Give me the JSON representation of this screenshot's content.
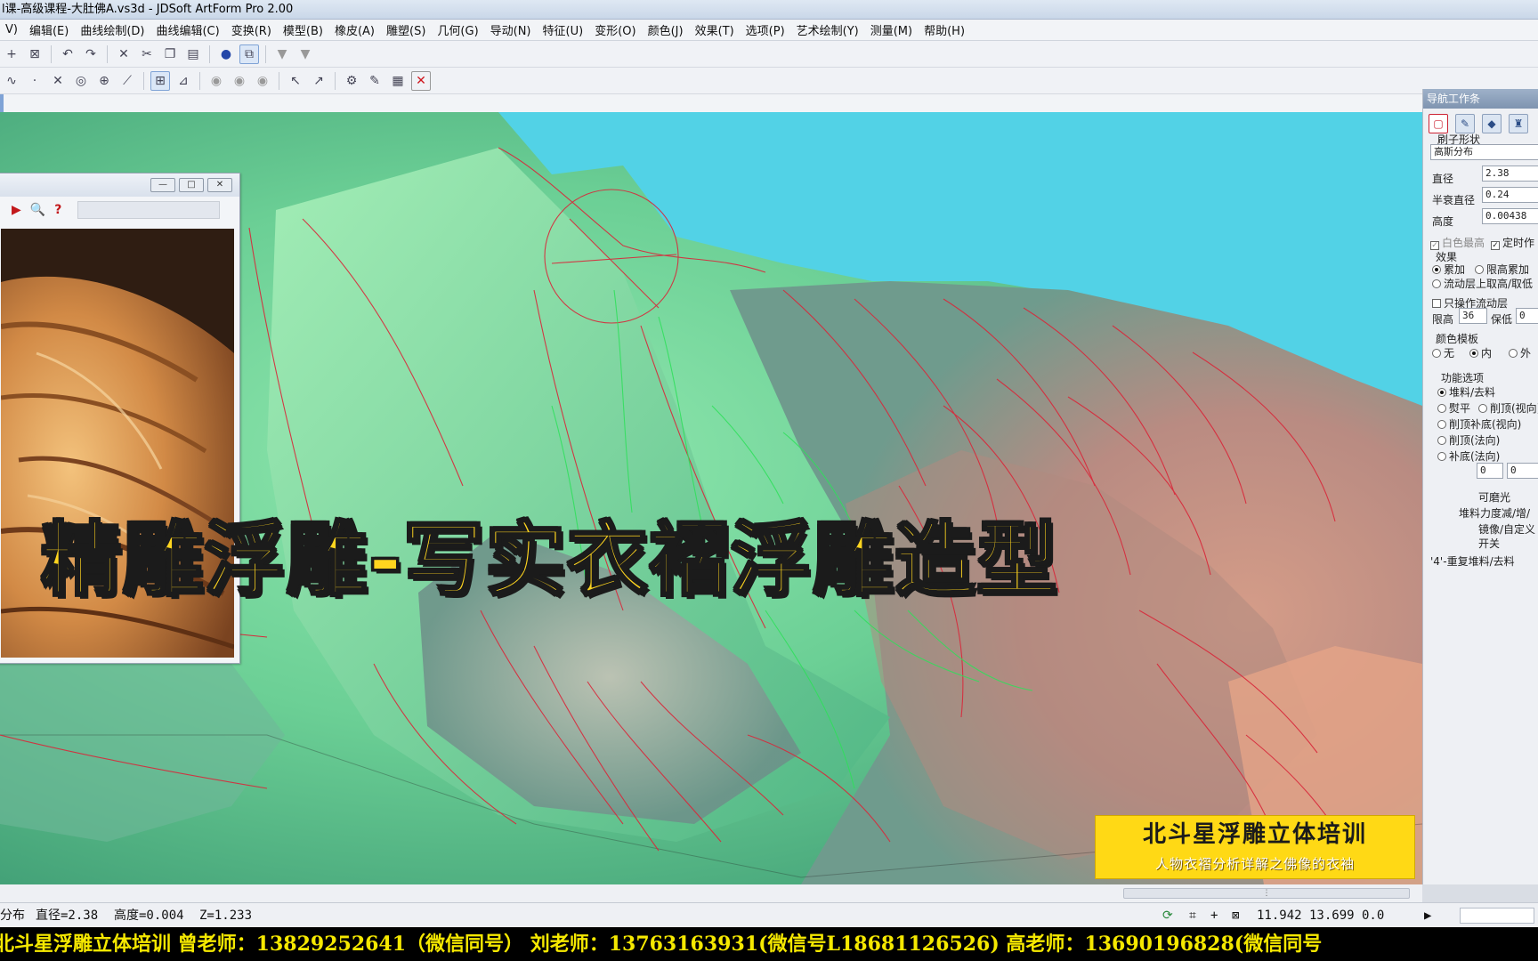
{
  "window": {
    "title": "l课-高级课程-大肚佛A.vs3d - JDSoft ArtForm Pro 2.00"
  },
  "menu": [
    "V)",
    "编辑(E)",
    "曲线绘制(D)",
    "曲线编辑(C)",
    "变换(R)",
    "模型(B)",
    "橡皮(A)",
    "雕塑(S)",
    "几何(G)",
    "导动(N)",
    "特征(U)",
    "变形(O)",
    "颜色(J)",
    "效果(T)",
    "选项(P)",
    "艺术绘制(Y)",
    "测量(M)",
    "帮助(H)"
  ],
  "toolbar1_icons": [
    "axis-icon",
    "frame-icon",
    "undo-icon",
    "redo-icon",
    "delete-icon",
    "cut-icon",
    "copy-icon",
    "paste-icon",
    "sphere-render-icon",
    "view-box-icon",
    "shade-icon",
    "shade-alt-icon"
  ],
  "toolbar2_icons": [
    "curve-icon",
    "point-icon",
    "cross-icon",
    "circle-icon",
    "target-icon",
    "trim-icon",
    "grid-icon",
    "snap-icon",
    "eye-icon",
    "eye2-icon",
    "eye3-icon",
    "select-icon",
    "select2-icon",
    "tool-icon",
    "brush-icon",
    "layer-icon",
    "close-red-icon"
  ],
  "ref_window": {
    "buttons": [
      "—",
      "□",
      "✕"
    ],
    "tools": [
      "▶",
      "🔍",
      "?"
    ]
  },
  "nav_panel": {
    "title": "导航工作条",
    "brush_shape_label": "刷子形状",
    "brush_shape_value": "高斯分布",
    "diameter_label": "直径",
    "diameter_value": "2.38",
    "half_decay_label": "半衰直径",
    "half_decay_value": "0.24",
    "height_label": "高度",
    "height_value": "0.00438",
    "white_max_label": "白色最高",
    "timed_label": "定时作",
    "effect_label": "效果",
    "effect_accumulate": "累加",
    "effect_limit_accumulate": "限高累加",
    "effect_flow_layer": "流动层上取高/取低",
    "only_flow_layer": "只操作流动层",
    "limit_high_label": "限高",
    "limit_high_value": "36",
    "keep_low_label": "保低",
    "keep_low_value": "0",
    "color_template_label": "颜色模板",
    "color_none": "无",
    "color_inner": "内",
    "color_outer": "外",
    "function_label": "功能选项",
    "fn_pile": "堆料/去料",
    "fn_flatten": "熨平",
    "fn_cut_top": "削顶(视向)",
    "fn_cut_fill": "削顶补底(视向)",
    "fn_cut_normal": "削顶(法向)",
    "fn_fill_normal": "补底(法向)",
    "fn_val1": "0",
    "fn_val2": "0",
    "fn_polish": "可磨光",
    "fn_pile_force": "堆料力度减/增/",
    "fn_mirror": "镜像/自定义",
    "fn_switch": "开关",
    "fn_repeat": "'4'-重复堆料/去料"
  },
  "status": {
    "mode": "分布",
    "diameter": "直径=2.38",
    "height": "高度=0.004",
    "z": "Z=1.233",
    "coords": "11.942 13.699 0.0"
  },
  "overlay_title": "精雕浮雕-写实衣褶浮雕造型",
  "banner": {
    "line1": "北斗星浮雕立体培训",
    "line2": "人物衣褶分析详解之佛像的衣袖"
  },
  "ticker": "北斗星浮雕立体培训 曾老师：13829252641（微信同号） 刘老师：13763163931(微信号L18681126526) 高老师：13690196828(微信同号",
  "colors": {
    "sky": "#52d2e6",
    "relief_green": "#7fd9a0",
    "overlay_yellow": "#ffd51f",
    "banner_yellow": "#ffd915",
    "ticker_yellow": "#f5e800",
    "curve_red": "#d8283a",
    "curve_green": "#2ee05a"
  }
}
